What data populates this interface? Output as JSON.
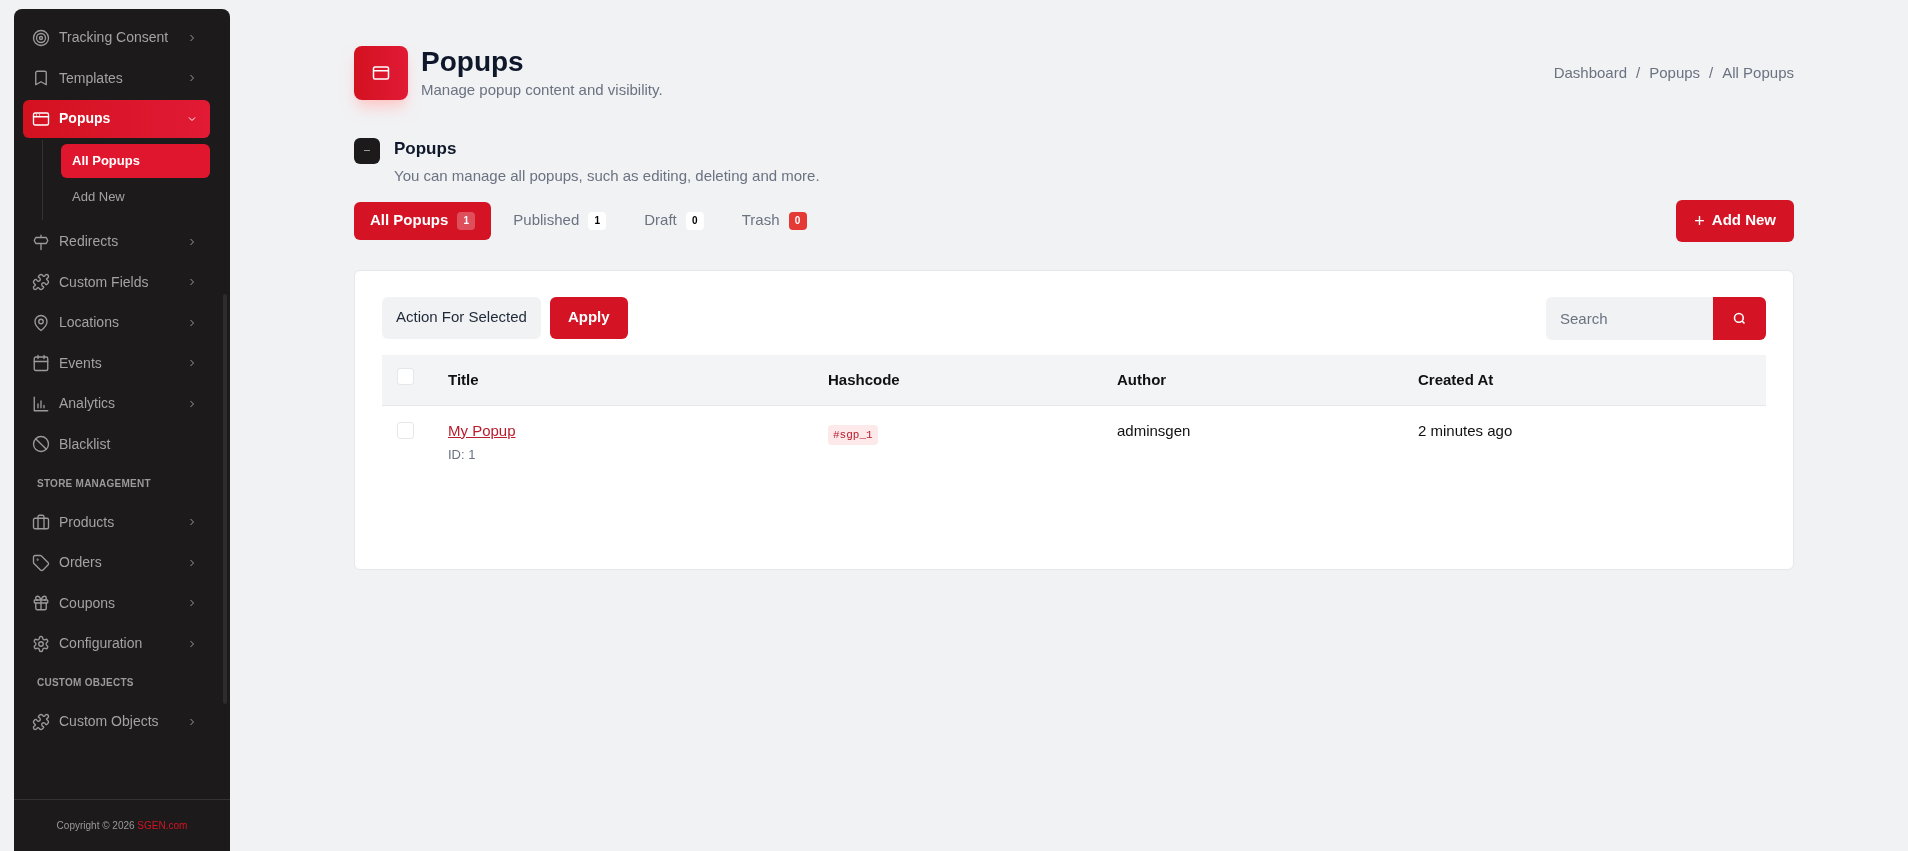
{
  "sidebar": {
    "sections": [
      {
        "items": [
          {
            "label": "Tracking Consent",
            "kind": "menu",
            "selected": false,
            "expanded": false
          },
          {
            "label": "Templates",
            "kind": "menu",
            "selected": false,
            "expanded": false
          },
          {
            "label": "Popups",
            "kind": "menu",
            "selected": true,
            "expanded": true,
            "children": [
              {
                "label": "All Popups",
                "selected": true
              },
              {
                "label": "Add New",
                "selected": false
              }
            ]
          },
          {
            "label": "Redirects",
            "kind": "menu",
            "selected": false,
            "expanded": false
          },
          {
            "label": "Custom Fields",
            "kind": "menu",
            "selected": false,
            "expanded": false
          },
          {
            "label": "Locations",
            "kind": "menu",
            "selected": false,
            "expanded": false
          },
          {
            "label": "Events",
            "kind": "menu",
            "selected": false,
            "expanded": false
          },
          {
            "label": "Analytics",
            "kind": "menu",
            "selected": false,
            "expanded": false
          },
          {
            "label": "Blacklist",
            "kind": "link",
            "selected": false
          }
        ]
      },
      {
        "heading": "STORE MANAGEMENT",
        "items": [
          {
            "label": "Products",
            "kind": "menu",
            "selected": false,
            "expanded": false
          },
          {
            "label": "Orders",
            "kind": "menu",
            "selected": false,
            "expanded": false
          },
          {
            "label": "Coupons",
            "kind": "menu",
            "selected": false,
            "expanded": false
          },
          {
            "label": "Configuration",
            "kind": "menu",
            "selected": false,
            "expanded": false
          }
        ]
      },
      {
        "heading": "CUSTOM OBJECTS",
        "items": [
          {
            "label": "Custom Objects",
            "kind": "menu",
            "selected": false,
            "expanded": false
          }
        ]
      }
    ],
    "footer": {
      "text": "Copyright © 2026",
      "link": "SGEN.com"
    }
  },
  "header": {
    "title": "Popups",
    "subtitle": "Manage popup content and visibility.",
    "breadcrumb": {
      "separator": "/",
      "items": [
        "Dashboard",
        "Popups",
        "All Popups"
      ]
    }
  },
  "section": {
    "title": "Popups",
    "description": "You can manage all popups, such as editing, deleting and more."
  },
  "tabs": [
    {
      "label": "All Popups",
      "count": "1",
      "kind": "count",
      "selected": true
    },
    {
      "label": "Published",
      "count": "1",
      "kind": "count",
      "selected": false
    },
    {
      "label": "Draft",
      "count": "0",
      "kind": "count",
      "selected": false
    },
    {
      "label": "Trash",
      "count": "0",
      "kind": "alert",
      "selected": false
    }
  ],
  "add_button": {
    "icon": "+",
    "label": "Add New"
  },
  "toolbar": {
    "action": "Action For Selected",
    "apply": "Apply",
    "search_placeholder": "Search"
  },
  "table": {
    "select_all_checked": false,
    "columns": [
      "Title",
      "Hashcode",
      "Author",
      "Created At"
    ],
    "rows": [
      {
        "checked": false,
        "title": "My Popup",
        "id": "ID: 1",
        "hashcode": "#sgp_1",
        "author": "adminsgen",
        "created_at": "2 minutes ago"
      }
    ]
  }
}
